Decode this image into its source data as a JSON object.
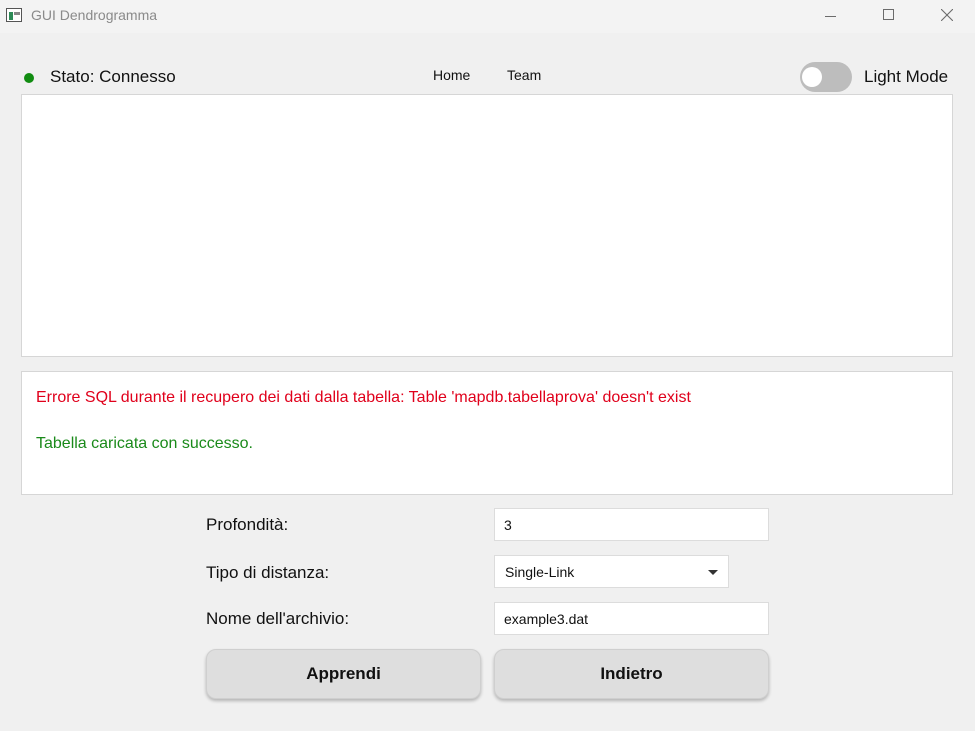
{
  "window": {
    "title": "GUI Dendrogramma"
  },
  "topbar": {
    "status_label": "Stato: Connesso",
    "status_color": "#118c11",
    "nav": [
      {
        "label": "Home"
      },
      {
        "label": "Team"
      }
    ],
    "theme_toggle": {
      "label": "Light Mode",
      "on": false
    }
  },
  "log": {
    "error": "Errore SQL durante il recupero dei dati dalla tabella: Table 'mapdb.tabellaprova' doesn't exist",
    "success": "Tabella caricata con successo.",
    "error_color": "#e0001b",
    "success_color": "#1a8a1a"
  },
  "form": {
    "depth_label": "Profondità:",
    "depth_value": "3",
    "distance_label": "Tipo di distanza:",
    "distance_value": "Single-Link",
    "file_label": "Nome dell'archivio:",
    "file_value": "example3.dat"
  },
  "buttons": {
    "learn": "Apprendi",
    "back": "Indietro"
  }
}
